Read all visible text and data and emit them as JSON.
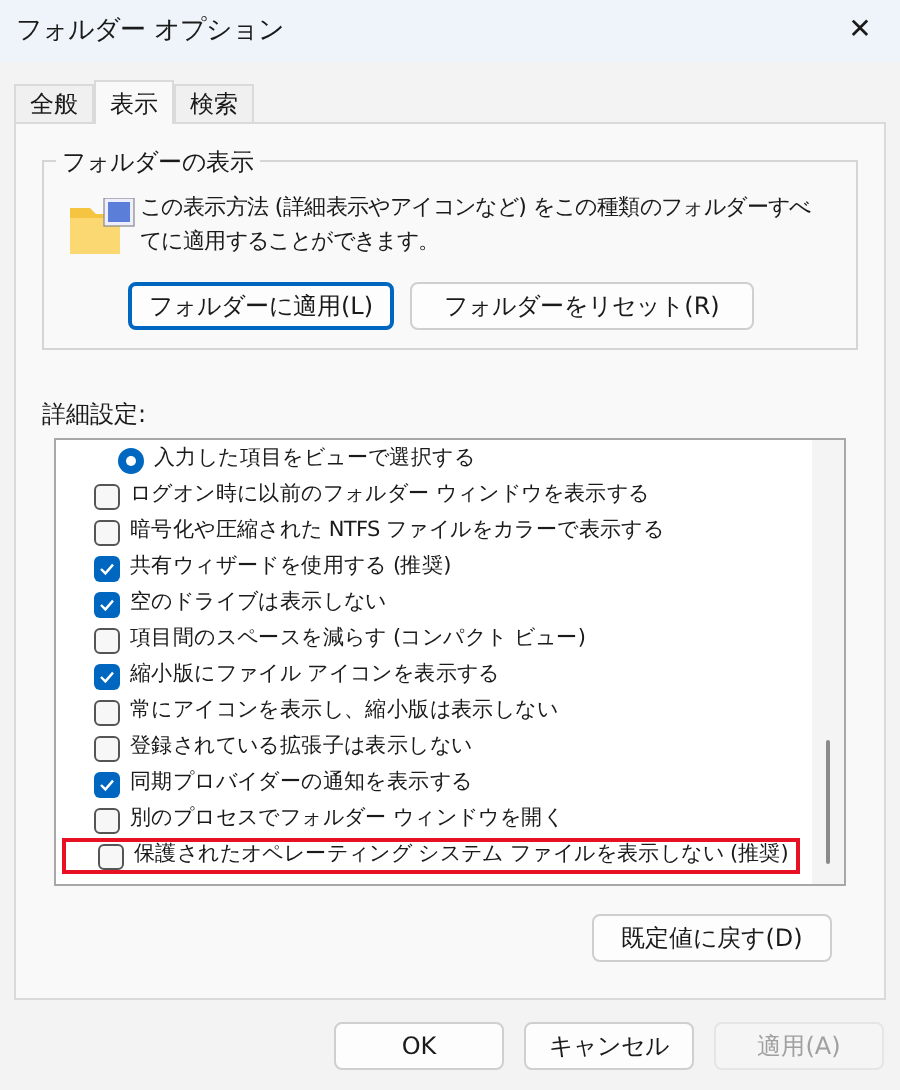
{
  "window": {
    "title": "フォルダー オプション",
    "close": "✕"
  },
  "tabs": [
    {
      "label": "全般",
      "selected": false
    },
    {
      "label": "表示",
      "selected": true
    },
    {
      "label": "検索",
      "selected": false
    }
  ],
  "folder_views": {
    "title": "フォルダーの表示",
    "description": "この表示方法 (詳細表示やアイコンなど) をこの種類のフォルダーすべてに適用することができます。",
    "buttons": [
      {
        "label": "フォルダーに適用(L)",
        "focused": true
      },
      {
        "label": "フォルダーをリセット(R)",
        "focused": false
      }
    ]
  },
  "advanced": {
    "title": "詳細設定:",
    "items": [
      {
        "kind": "radio",
        "label": "入力した項目をビューで選択する",
        "checked": true,
        "highlighted": false
      },
      {
        "kind": "checkbox",
        "label": "ログオン時に以前のフォルダー ウィンドウを表示する",
        "checked": false,
        "highlighted": false
      },
      {
        "kind": "checkbox",
        "label": "暗号化や圧縮された NTFS ファイルをカラーで表示する",
        "checked": false,
        "highlighted": false
      },
      {
        "kind": "checkbox",
        "label": "共有ウィザードを使用する (推奨)",
        "checked": true,
        "highlighted": false
      },
      {
        "kind": "checkbox",
        "label": "空のドライブは表示しない",
        "checked": true,
        "highlighted": false
      },
      {
        "kind": "checkbox",
        "label": "項目間のスペースを減らす (コンパクト ビュー)",
        "checked": false,
        "highlighted": false
      },
      {
        "kind": "checkbox",
        "label": "縮小版にファイル アイコンを表示する",
        "checked": true,
        "highlighted": false
      },
      {
        "kind": "checkbox",
        "label": "常にアイコンを表示し、縮小版は表示しない",
        "checked": false,
        "highlighted": false
      },
      {
        "kind": "checkbox",
        "label": "登録されている拡張子は表示しない",
        "checked": false,
        "highlighted": false
      },
      {
        "kind": "checkbox",
        "label": "同期プロバイダーの通知を表示する",
        "checked": true,
        "highlighted": false
      },
      {
        "kind": "checkbox",
        "label": "別のプロセスでフォルダー ウィンドウを開く",
        "checked": false,
        "highlighted": false
      },
      {
        "kind": "checkbox",
        "label": "保護されたオペレーティング システム ファイルを表示しない (推奨)",
        "checked": false,
        "highlighted": true
      }
    ],
    "restore_button": "既定値に戻す(D)"
  },
  "buttons": [
    {
      "label": "OK",
      "disabled": false
    },
    {
      "label": "キャンセル",
      "disabled": false
    },
    {
      "label": "適用(A)",
      "disabled": true
    }
  ]
}
